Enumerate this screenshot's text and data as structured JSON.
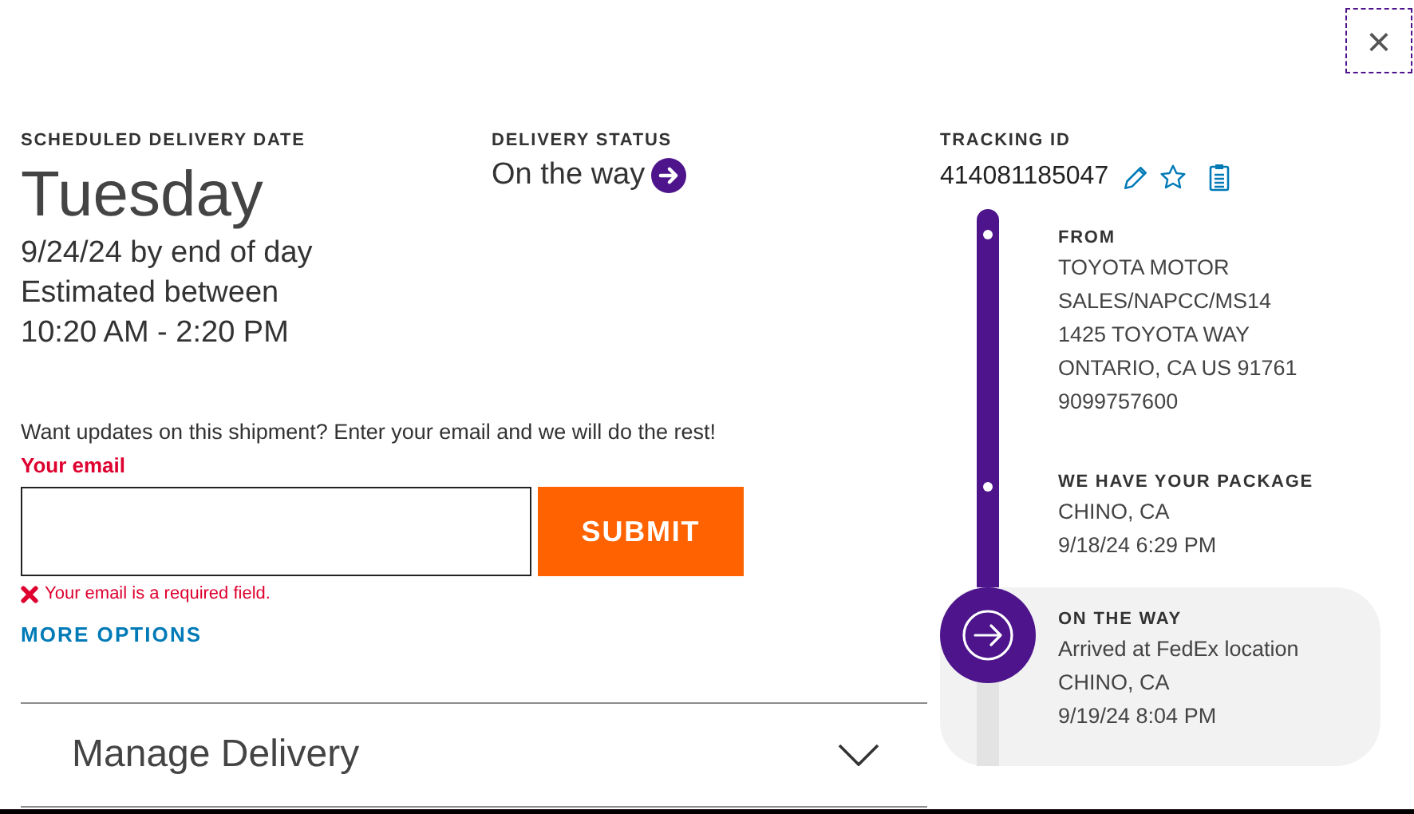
{
  "close_button": {
    "label": "×"
  },
  "scheduled": {
    "heading": "SCHEDULED DELIVERY DATE",
    "day": "Tuesday",
    "date": "9/24/24 by end of day",
    "estimate_label": "Estimated between",
    "window": "10:20 AM - 2:20 PM"
  },
  "status": {
    "heading": "DELIVERY STATUS",
    "value": "On the way"
  },
  "email_form": {
    "prompt": "Want updates on this shipment? Enter your email and we will do the rest!",
    "label": "Your email",
    "submit": "SUBMIT",
    "error": "Your email is a required field.",
    "more_options": "MORE OPTIONS"
  },
  "manage_delivery": {
    "label": "Manage Delivery",
    "expanded": false
  },
  "tracking": {
    "heading": "TRACKING ID",
    "number": "414081185047"
  },
  "events": [
    {
      "kind": "past",
      "title": "FROM",
      "lines": [
        "TOYOTA MOTOR",
        "SALES/NAPCC/MS14",
        "1425 TOYOTA WAY",
        "ONTARIO, CA US 91761",
        "9099757600"
      ]
    },
    {
      "kind": "past",
      "title": "WE HAVE YOUR PACKAGE",
      "lines": [
        "CHINO, CA",
        "9/18/24 6:29 PM"
      ]
    },
    {
      "kind": "current",
      "title": "ON THE WAY",
      "lines": [
        "Arrived at FedEx location",
        "CHINO, CA",
        "9/19/24 8:04 PM"
      ]
    }
  ]
}
